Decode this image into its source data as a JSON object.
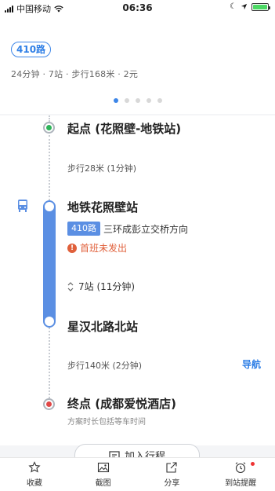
{
  "status_bar": {
    "carrier": "中国移动",
    "time": "06:36",
    "icons": [
      "signal-icon",
      "wifi-icon",
      "moon-icon",
      "location-icon",
      "battery-icon"
    ]
  },
  "summary": {
    "route_badge": "410路",
    "meta": "24分钟 · 7站 · 步行168米 · 2元",
    "page_dots": {
      "count": 5,
      "active_index": 0
    }
  },
  "route": {
    "start": {
      "title": "起点 (花照壁-地铁站)"
    },
    "walk1": "步行28米 (1分钟)",
    "board": {
      "title": "地铁花照壁站",
      "line_badge": "410路",
      "direction": "三环成彭立交桥方向",
      "warning": "首班未发出",
      "stops": "7站 (11分钟)"
    },
    "alight": {
      "title": "星汉北路北站"
    },
    "walk2": "步行140米 (2分钟)",
    "nav_link": "导航",
    "end": {
      "title": "终点 (成都爱悦酒店)",
      "note": "方案时长包括等车时间"
    }
  },
  "add_button": "加入行程",
  "toolbar": {
    "items": [
      {
        "label": "收藏",
        "icon": "star-icon"
      },
      {
        "label": "截图",
        "icon": "image-icon"
      },
      {
        "label": "分享",
        "icon": "share-icon"
      },
      {
        "label": "到站提醒",
        "icon": "alarm-icon"
      }
    ]
  },
  "colors": {
    "accent": "#3d86e8",
    "bus_line": "#5b8fe3",
    "warning": "#e0603b",
    "start": "#2fb45a",
    "end": "#e04848"
  }
}
